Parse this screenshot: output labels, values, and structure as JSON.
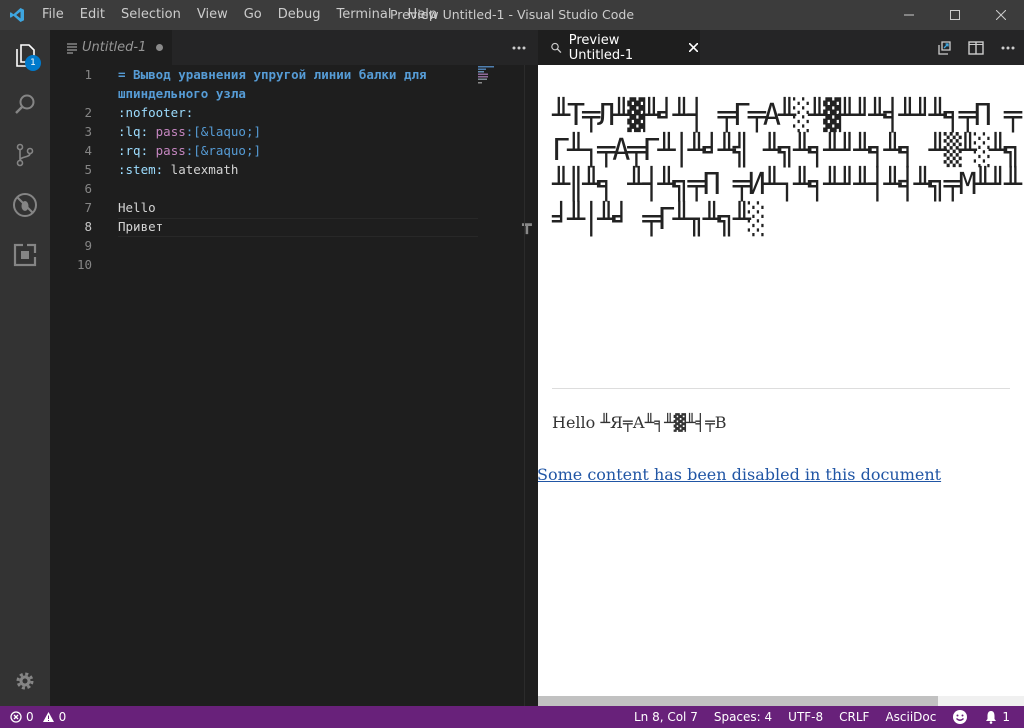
{
  "menu": [
    "File",
    "Edit",
    "Selection",
    "View",
    "Go",
    "Debug",
    "Terminal",
    "Help"
  ],
  "window_title": "Preview Untitled-1 - Visual Studio Code",
  "activity": {
    "explorer_badge": "1"
  },
  "editor": {
    "tab_label": "Untitled-1",
    "line_numbers": [
      "1",
      "",
      "2",
      "3",
      "4",
      "5",
      "6",
      "7",
      "8",
      "9",
      "10"
    ],
    "lines": {
      "l1a": "= Вывод уравнения упругой линии балки для",
      "l1b": "шпиндельного узла",
      "l2_key": ":nofooter:",
      "l3_key": ":lq:",
      "l3_macro": "pass",
      "l3_val": ":[&laquo;]",
      "l4_key": ":rq:",
      "l4_macro": "pass",
      "l4_val": ":[&raquo;]",
      "l5_key": ":stem:",
      "l5_val": " latexmath",
      "l7": "Hello",
      "l8": "Привет"
    }
  },
  "preview": {
    "tab_label": "Preview Untitled-1",
    "garbled_heading": "╨Т╤Л╨▓╨╛╨┤ ╤Г╤А╨░╨▓╨╜╨╡╨╜╨╕╤П ╤Г╨┐╤А╤Г╨│╨╛╨╣ ╨╗╨╕╨╜╨╕╨╕ ╨▒╨░╨╗╨║╨╕ ╨┤╨╗╤П ╤И╨┐╨╕╨╜╨┤╨╡╨╗╤М╨╜╨╛╨│╨╛ ╤Г╨╖╨╗╨░",
    "hello_line": "Hello ╨Я╤А╨╕╨▓╨╡╤В",
    "disabled_notice": "Some content has been disabled in this document"
  },
  "status": {
    "errors": "0",
    "warnings": "0",
    "position": "Ln 8, Col 7",
    "spaces": "Spaces: 4",
    "encoding": "UTF-8",
    "eol": "CRLF",
    "language": "AsciiDoc",
    "notifications": "1"
  },
  "colors": {
    "statusbar": "#68217a",
    "accent": "#007acc",
    "titlebar": "#3c3c3c"
  }
}
